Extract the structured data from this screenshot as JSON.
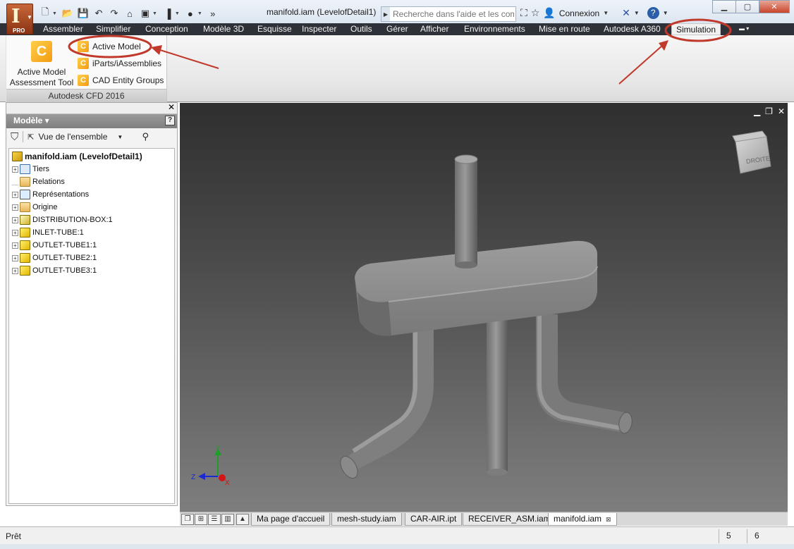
{
  "app": {
    "logo_letter": "I",
    "logo_badge": "PRO"
  },
  "titlebar": {
    "title": "manifold.iam (LevelofDetail1)"
  },
  "help": {
    "search_placeholder": "Recherche dans l'aide et les com"
  },
  "account": {
    "sign_in_label": "Connexion"
  },
  "ribbon_tabs": [
    "Assembler",
    "Simplifier",
    "Conception",
    "Modèle 3D",
    "Esquisse",
    "Inspecter",
    "Outils",
    "Gérer",
    "Afficher",
    "Environnements",
    "Mise en route",
    "Autodesk A360",
    "Simulation"
  ],
  "ribbon_panel": {
    "big_button": {
      "line1": "Active Model",
      "line2": "Assessment Tool"
    },
    "small_buttons": [
      "Active Model",
      "iParts/iAssemblies",
      "CAD Entity Groups"
    ],
    "footer": "Autodesk CFD 2016"
  },
  "browser": {
    "title": "Modèle ▾",
    "view_label": "Vue de l'ensemble",
    "tree": [
      {
        "label": "manifold.iam (LevelofDetail1)",
        "icon": "assembly-icon"
      },
      {
        "label": "Tiers",
        "icon": "levels-icon"
      },
      {
        "label": "Relations",
        "icon": "folder-icon"
      },
      {
        "label": "Représentations",
        "icon": "representations-icon"
      },
      {
        "label": "Origine",
        "icon": "folder-icon"
      },
      {
        "label": "DISTRIBUTION-BOX:1",
        "icon": "part-icon"
      },
      {
        "label": "INLET-TUBE:1",
        "icon": "part-icon"
      },
      {
        "label": "OUTLET-TUBE1:1",
        "icon": "part-icon"
      },
      {
        "label": "OUTLET-TUBE2:1",
        "icon": "part-icon"
      },
      {
        "label": "OUTLET-TUBE3:1",
        "icon": "part-icon"
      }
    ]
  },
  "viewcube": {
    "face_label": "DROITE"
  },
  "axes": {
    "x": "X",
    "y": "Y",
    "z": "Z"
  },
  "doc_tabs": [
    "Ma page d'accueil",
    "mesh-study.iam",
    "CAR-AIR.ipt",
    "RECEIVER_ASM.iam",
    "manifold.iam"
  ],
  "status": {
    "text": "Prêt",
    "cell1": "5",
    "cell2": "6"
  },
  "colors": {
    "ribbon_dark": "#2e3238",
    "annotation_red": "#c0392b",
    "viewport_top": "#2f2f2f",
    "viewport_bottom": "#7e7e7e"
  }
}
